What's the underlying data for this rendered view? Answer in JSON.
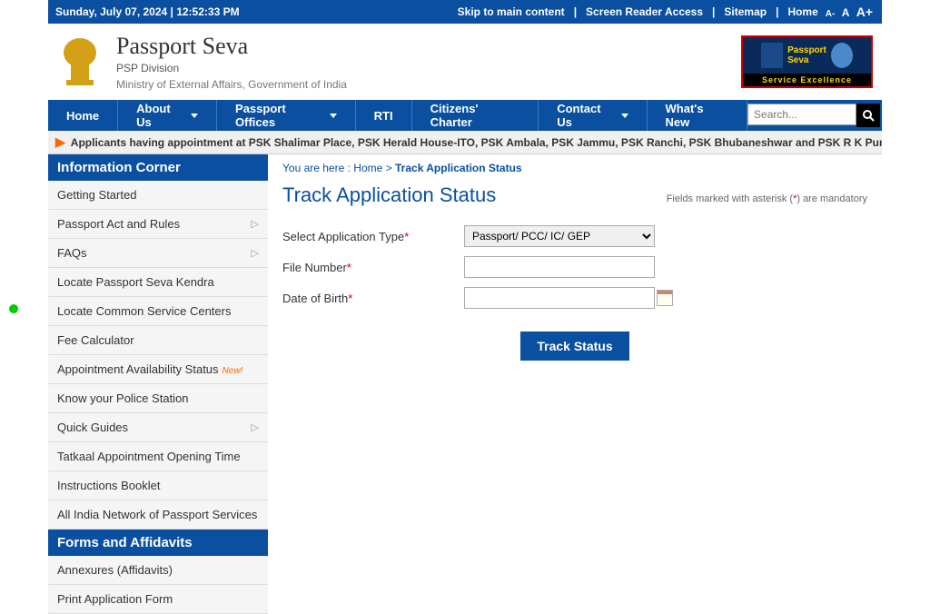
{
  "topbar": {
    "datetime": "Sunday,  July  07, 2024 | 12:52:33 PM",
    "skip": "Skip to main content",
    "screen_reader": "Screen Reader Access",
    "sitemap": "Sitemap",
    "home": "Home",
    "font_minus": "A-",
    "font_normal": "A",
    "font_plus": "A+"
  },
  "header": {
    "title": "Passport Seva",
    "sub1": "PSP Division",
    "sub2": "Ministry of External Affairs, Government of India",
    "badge_line1": "Passport",
    "badge_line2": "Seva",
    "badge_bottom": "Service Excellence"
  },
  "nav": {
    "home": "Home",
    "about": "About Us",
    "offices": "Passport Offices",
    "rti": "RTI",
    "charter": "Citizens' Charter",
    "contact": "Contact Us",
    "whats_new": "What's New",
    "search_placeholder": "Search..."
  },
  "ticker": "Applicants having appointment at PSK Shalimar Place, PSK Herald House-ITO, PSK Ambala, PSK Jammu, PSK Ranchi, PSK Bhubaneshwar and PSK R K Puram kindly no",
  "sidebar": {
    "header1": "Information Corner",
    "items1": [
      {
        "label": "Getting Started",
        "arrow": false
      },
      {
        "label": "Passport Act and Rules",
        "arrow": true
      },
      {
        "label": "FAQs",
        "arrow": true
      },
      {
        "label": "Locate Passport Seva Kendra",
        "arrow": false
      },
      {
        "label": "Locate Common Service Centers",
        "arrow": false
      },
      {
        "label": "Fee Calculator",
        "arrow": false
      },
      {
        "label": "Appointment Availability Status",
        "arrow": false,
        "new": true
      },
      {
        "label": "Know your Police Station",
        "arrow": false
      },
      {
        "label": "Quick Guides",
        "arrow": true
      },
      {
        "label": "Tatkaal Appointment Opening Time",
        "arrow": false
      },
      {
        "label": "Instructions Booklet",
        "arrow": false
      },
      {
        "label": "All India Network of Passport Services",
        "arrow": false
      }
    ],
    "header2": "Forms and Affidavits",
    "items2": [
      {
        "label": "Annexures (Affidavits)",
        "arrow": false
      },
      {
        "label": "Print Application Form",
        "arrow": false
      }
    ],
    "new_text": "New!"
  },
  "breadcrumb": {
    "prefix": "You are here :",
    "home": "Home",
    "sep": ">",
    "current": "Track Application Status"
  },
  "content": {
    "title": "Track Application Status",
    "mandatory": "Fields marked with asterisk (",
    "mandatory_ast": "*",
    "mandatory_end": ") are mandatory",
    "app_type_label": "Select Application Type",
    "app_type_selected": "Passport/ PCC/ IC/ GEP",
    "file_num_label": "File Number",
    "dob_label": "Date of Birth",
    "submit": "Track Status"
  }
}
